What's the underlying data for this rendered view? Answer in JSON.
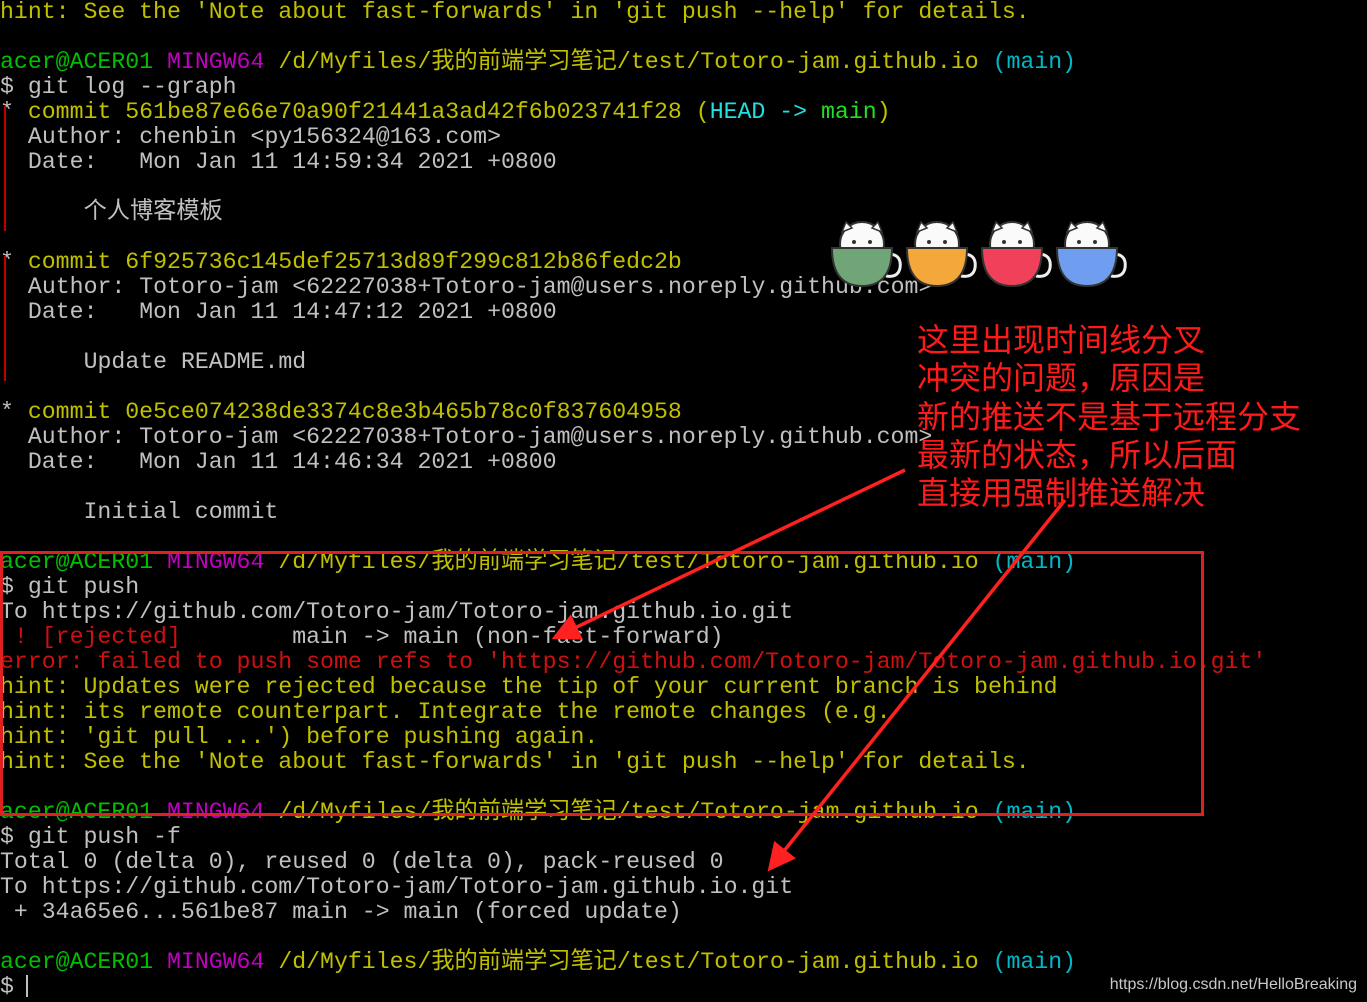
{
  "terminal": {
    "lines": [
      {
        "segs": [
          {
            "t": "hint: See the 'Note about fast-forwards' in 'git push --help' for details.",
            "c": "yel"
          }
        ]
      },
      {
        "segs": []
      },
      {
        "segs": [
          {
            "t": "acer@ACER01 ",
            "c": "green"
          },
          {
            "t": "MINGW64 ",
            "c": "mag"
          },
          {
            "t": "/d/Myfiles/我的前端学习笔记/test/Totoro-jam.github.io ",
            "c": "yel"
          },
          {
            "t": "(main)",
            "c": "cyan"
          }
        ]
      },
      {
        "segs": [
          {
            "t": "$ git log --graph",
            "c": "def"
          }
        ]
      },
      {
        "segs": [
          {
            "t": "* ",
            "c": "def"
          },
          {
            "t": "commit 561be87e66e70a90f21441a3ad42f6b023741f28 ",
            "c": "yel"
          },
          {
            "t": "(",
            "c": "yel"
          },
          {
            "t": "HEAD -> ",
            "c": "headcyan"
          },
          {
            "t": "main",
            "c": "headgreen"
          },
          {
            "t": ")",
            "c": "yel"
          }
        ]
      },
      {
        "bar": true,
        "segs": [
          {
            "t": " Author: chenbin <py156324@163.com>",
            "c": "def"
          }
        ]
      },
      {
        "bar": true,
        "segs": [
          {
            "t": " Date:   Mon Jan 11 14:59:34 2021 +0800",
            "c": "def"
          }
        ]
      },
      {
        "bar": true,
        "segs": []
      },
      {
        "bar": true,
        "segs": [
          {
            "t": "     个人博客模板",
            "c": "def"
          }
        ]
      },
      {
        "bar": true,
        "segs": []
      },
      {
        "segs": [
          {
            "t": "* ",
            "c": "def"
          },
          {
            "t": "commit 6f925736c145def25713d89f299c812b86fedc2b",
            "c": "yel"
          }
        ]
      },
      {
        "bar": true,
        "segs": [
          {
            "t": " Author: Totoro-jam <62227038+Totoro-jam@users.noreply.github.com>",
            "c": "def"
          }
        ]
      },
      {
        "bar": true,
        "segs": [
          {
            "t": " Date:   Mon Jan 11 14:47:12 2021 +0800",
            "c": "def"
          }
        ]
      },
      {
        "bar": true,
        "segs": []
      },
      {
        "bar": true,
        "segs": [
          {
            "t": "     Update README.md",
            "c": "def"
          }
        ]
      },
      {
        "bar": true,
        "segs": []
      },
      {
        "segs": [
          {
            "t": "* ",
            "c": "def"
          },
          {
            "t": "commit 0e5ce074238de3374c8e3b465b78c0f837604958",
            "c": "yel"
          }
        ]
      },
      {
        "segs": [
          {
            "t": "  Author: Totoro-jam <62227038+Totoro-jam@users.noreply.github.com>",
            "c": "def"
          }
        ]
      },
      {
        "segs": [
          {
            "t": "  Date:   Mon Jan 11 14:46:34 2021 +0800",
            "c": "def"
          }
        ]
      },
      {
        "segs": []
      },
      {
        "segs": [
          {
            "t": "      Initial commit",
            "c": "def"
          }
        ]
      },
      {
        "segs": []
      },
      {
        "segs": [
          {
            "t": "acer@ACER01 ",
            "c": "green"
          },
          {
            "t": "MINGW64 ",
            "c": "mag"
          },
          {
            "t": "/d/Myfiles/我的前端学习笔记/test/Totoro-jam.github.io ",
            "c": "yel"
          },
          {
            "t": "(main)",
            "c": "cyan"
          }
        ]
      },
      {
        "segs": [
          {
            "t": "$ git push",
            "c": "def"
          }
        ]
      },
      {
        "segs": [
          {
            "t": "To https://github.com/Totoro-jam/Totoro-jam.github.io.git",
            "c": "def"
          }
        ]
      },
      {
        "segs": [
          {
            "t": " ! [rejected]",
            "c": "red"
          },
          {
            "t": "        main -> main (non-fast-forward)",
            "c": "def"
          }
        ]
      },
      {
        "segs": [
          {
            "t": "error: failed to push some refs to 'https://github.com/Totoro-jam/Totoro-jam.github.io.git'",
            "c": "red"
          }
        ]
      },
      {
        "segs": [
          {
            "t": "hint: Updates were rejected because the tip of your current branch is behind",
            "c": "yel"
          }
        ]
      },
      {
        "segs": [
          {
            "t": "hint: its remote counterpart. Integrate the remote changes (e.g.",
            "c": "yel"
          }
        ]
      },
      {
        "segs": [
          {
            "t": "hint: 'git pull ...') before pushing again.",
            "c": "yel"
          }
        ]
      },
      {
        "segs": [
          {
            "t": "hint: See the 'Note about fast-forwards' in 'git push --help' for details.",
            "c": "yel"
          }
        ]
      },
      {
        "segs": []
      },
      {
        "segs": [
          {
            "t": "acer@ACER01 ",
            "c": "green"
          },
          {
            "t": "MINGW64 ",
            "c": "mag"
          },
          {
            "t": "/d/Myfiles/我的前端学习笔记/test/Totoro-jam.github.io ",
            "c": "yel"
          },
          {
            "t": "(main)",
            "c": "cyan"
          }
        ]
      },
      {
        "segs": [
          {
            "t": "$ git push -f",
            "c": "def"
          }
        ]
      },
      {
        "segs": [
          {
            "t": "Total 0 (delta 0), reused 0 (delta 0), pack-reused 0",
            "c": "def"
          }
        ]
      },
      {
        "segs": [
          {
            "t": "To https://github.com/Totoro-jam/Totoro-jam.github.io.git",
            "c": "def"
          }
        ]
      },
      {
        "segs": [
          {
            "t": " + 34a65e6...561be87 main -> main (forced update)",
            "c": "def"
          }
        ]
      },
      {
        "segs": []
      },
      {
        "segs": [
          {
            "t": "acer@ACER01 ",
            "c": "green"
          },
          {
            "t": "MINGW64 ",
            "c": "mag"
          },
          {
            "t": "/d/Myfiles/我的前端学习笔记/test/Totoro-jam.github.io ",
            "c": "yel"
          },
          {
            "t": "(main)",
            "c": "cyan"
          }
        ]
      },
      {
        "cursor": true,
        "segs": [
          {
            "t": "$",
            "c": "def"
          }
        ]
      }
    ]
  },
  "annotation": {
    "lines": [
      "这里出现时间线分叉",
      "冲突的问题，原因是",
      "新的推送不是基于远程分支",
      "最新的状态，所以后面",
      "直接用强制推送解决"
    ],
    "color": "#ff1a1a"
  },
  "stickers": {
    "cups": [
      "cat-cup-green",
      "cat-cup-orange",
      "cat-cup-red",
      "cat-cup-blue"
    ],
    "cup_colors": [
      "#6fa577",
      "#f5a83a",
      "#f0405a",
      "#6f9ef0"
    ]
  },
  "watermark": "https://blog.csdn.net/HelloBreaking"
}
